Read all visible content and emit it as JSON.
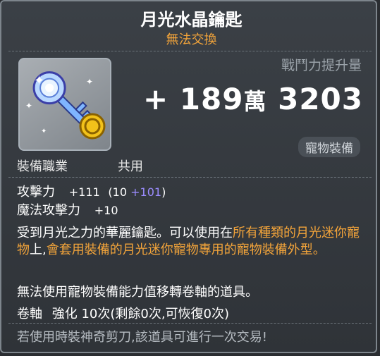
{
  "item": {
    "name": "月光水晶鑰匙",
    "trade_status": "無法交換",
    "power_label": "戰鬥力提升量",
    "power_sign": "+",
    "power_major": "189",
    "power_unit": "萬",
    "power_minor": "3203",
    "pet_badge": "寵物裝備",
    "job_label": "裝備職業",
    "job_value": "共用"
  },
  "stats": [
    {
      "label": "攻擊力",
      "value": "+111",
      "detail_open": "(10 ",
      "detail_bonus": "+101",
      "detail_close": ")"
    },
    {
      "label": "魔法攻擊力",
      "value": "+10"
    }
  ],
  "description": {
    "part1": "受到月光之力的華麗鑰匙。可以使用在",
    "highlight1": "所有種類的月光迷你寵物",
    "part2": "上,",
    "highlight2": "會套用裝備的月光迷你寵物專用的寵物裝備外型。"
  },
  "notes": {
    "no_transfer": "無法使用寵物裝備能力值移轉卷軸的道具。",
    "scroll_label": "卷軸",
    "scroll_text": "強化 10次(剩餘0次,可恢復0次)",
    "tradeable_hint": "若使用時裝神奇剪刀,該道具可進行一次交易!"
  },
  "colors": {
    "accent_orange": "#f3a43a",
    "bonus_blue": "#9b8cff",
    "background": "#363a3f"
  }
}
